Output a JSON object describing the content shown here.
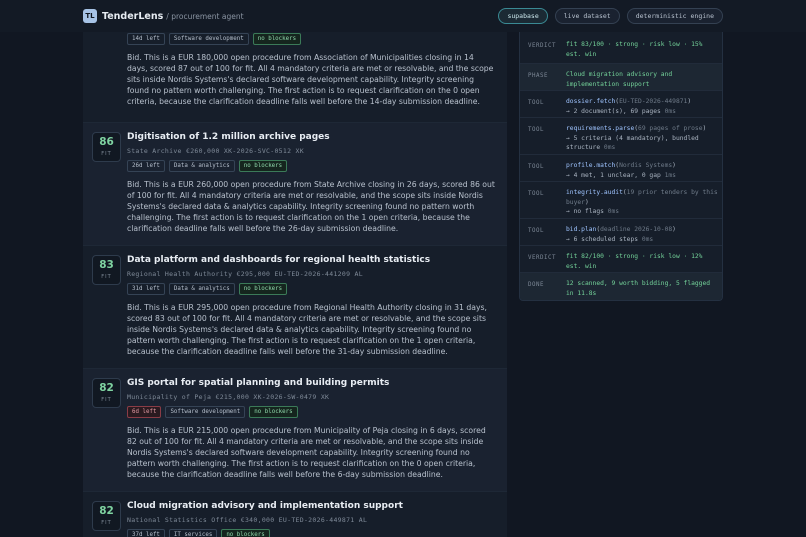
{
  "header": {
    "logo_text": "TL",
    "brand": "TenderLens",
    "subtitle": "/ procurement agent",
    "pills": [
      "supabase",
      "live dataset",
      "deterministic engine"
    ]
  },
  "cards": [
    {
      "score": "",
      "fit_label": "",
      "title": "",
      "meta": "",
      "tags": [
        {
          "label": "14d left",
          "kind": "neutral"
        },
        {
          "label": "Software development",
          "kind": "neutral"
        },
        {
          "label": "no blockers",
          "kind": "ok"
        }
      ],
      "desc": "Bid. This is a EUR 180,000 open procedure from Association of Municipalities closing in 14 days, scored 87 out of 100 for fit. All 4 mandatory criteria are met or resolvable, and the scope sits inside Nordis Systems's declared software development capability. Integrity screening found no pattern worth challenging. The first action is to request clarification on the 0 open criteria, because the clarification deadline falls well before the 14-day submission deadline."
    },
    {
      "score": "86",
      "fit_label": "FIT",
      "title": "Digitisation of 1.2 million archive pages",
      "meta": "State Archive  €260,000  XK-2026-SVC-0512  XK",
      "tags": [
        {
          "label": "26d left",
          "kind": "neutral"
        },
        {
          "label": "Data & analytics",
          "kind": "neutral"
        },
        {
          "label": "no blockers",
          "kind": "ok"
        }
      ],
      "desc": "Bid. This is a EUR 260,000 open procedure from State Archive closing in 26 days, scored 86 out of 100 for fit. All 4 mandatory criteria are met or resolvable, and the scope sits inside Nordis Systems's declared data & analytics capability. Integrity screening found no pattern worth challenging. The first action is to request clarification on the 1 open criteria, because the clarification deadline falls well before the 26-day submission deadline."
    },
    {
      "score": "83",
      "fit_label": "FIT",
      "title": "Data platform and dashboards for regional health statistics",
      "meta": "Regional Health Authority  €295,000  EU-TED-2026-441209  AL",
      "tags": [
        {
          "label": "31d left",
          "kind": "neutral"
        },
        {
          "label": "Data & analytics",
          "kind": "neutral"
        },
        {
          "label": "no blockers",
          "kind": "ok"
        }
      ],
      "desc": "Bid. This is a EUR 295,000 open procedure from Regional Health Authority closing in 31 days, scored 83 out of 100 for fit. All 4 mandatory criteria are met or resolvable, and the scope sits inside Nordis Systems's declared data & analytics capability. Integrity screening found no pattern worth challenging. The first action is to request clarification on the 1 open criteria, because the clarification deadline falls well before the 31-day submission deadline."
    },
    {
      "score": "82",
      "fit_label": "FIT",
      "title": "GIS portal for spatial planning and building permits",
      "meta": "Municipality of Peja  €215,000  XK-2026-SW-0479  XK",
      "tags": [
        {
          "label": "6d left",
          "kind": "warn"
        },
        {
          "label": "Software development",
          "kind": "neutral"
        },
        {
          "label": "no blockers",
          "kind": "ok"
        }
      ],
      "desc": "Bid. This is a EUR 215,000 open procedure from Municipality of Peja closing in 6 days, scored 82 out of 100 for fit. All 4 mandatory criteria are met or resolvable, and the scope sits inside Nordis Systems's declared software development capability. Integrity screening found no pattern worth challenging. The first action is to request clarification on the 0 open criteria, because the clarification deadline falls well before the 6-day submission deadline."
    },
    {
      "score": "82",
      "fit_label": "FIT",
      "title": "Cloud migration advisory and implementation support",
      "meta": "National Statistics Office  €340,000  EU-TED-2026-449871  AL",
      "tags": [
        {
          "label": "37d left",
          "kind": "neutral"
        },
        {
          "label": "IT services",
          "kind": "neutral"
        },
        {
          "label": "no blockers",
          "kind": "ok"
        }
      ],
      "desc": ""
    }
  ],
  "panel": {
    "rows": [
      {
        "label": "VERDICT",
        "lines": [
          {
            "t": "fit 83/100 · strong · risk low · 15% est. win",
            "c": "green"
          }
        ]
      },
      {
        "label": "PHASE",
        "lines": [
          {
            "t": "Cloud migration advisory and implementation support",
            "c": "green"
          }
        ]
      },
      {
        "label": "TOOL",
        "fn": "dossier.fetch",
        "arg": "EU-TED-2026-449871",
        "out": "→ 2 document(s), 69 pages",
        "ms": "0ms"
      },
      {
        "label": "TOOL",
        "fn": "requirements.parse",
        "arg": "69 pages of prose",
        "out": "→ 5 criteria (4 mandatory), bundled structure",
        "ms": "0ms"
      },
      {
        "label": "TOOL",
        "fn": "profile.match",
        "arg": "Nordis Systems",
        "out": "→ 4 met, 1 unclear, 0 gap",
        "ms": "1ms"
      },
      {
        "label": "TOOL",
        "fn": "integrity.audit",
        "arg": "19 prior tenders by this buyer",
        "out": "→ no flags",
        "ms": "0ms"
      },
      {
        "label": "TOOL",
        "fn": "bid.plan",
        "arg": "deadline 2026-10-08",
        "out": "→ 6 scheduled steps",
        "ms": "0ms"
      },
      {
        "label": "VERDICT",
        "lines": [
          {
            "t": "fit 82/100 · strong · risk low · 12% est. win",
            "c": "green"
          }
        ]
      },
      {
        "label": "DONE",
        "lines": [
          {
            "t": "12 scanned, 9 worth bidding, 5 flagged in 11.8s",
            "c": "green"
          }
        ]
      }
    ]
  }
}
